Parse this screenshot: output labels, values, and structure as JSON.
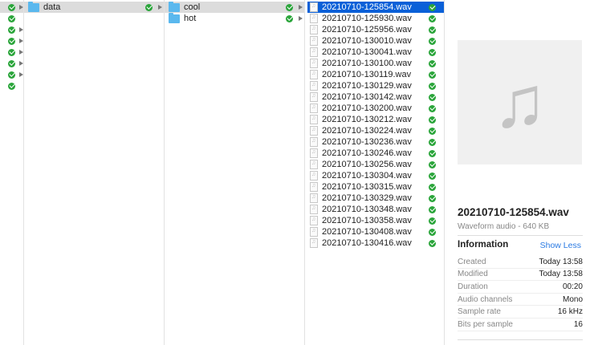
{
  "column0": {
    "rows": [
      {
        "arrow": true
      },
      {
        "arrow": false
      },
      {
        "arrow": true
      },
      {
        "arrow": true
      },
      {
        "arrow": true
      },
      {
        "arrow": true
      },
      {
        "arrow": true
      },
      {
        "arrow": false
      }
    ]
  },
  "column1": {
    "items": [
      {
        "name": "data"
      }
    ]
  },
  "column2": {
    "items": [
      {
        "name": "cool"
      },
      {
        "name": "hot"
      }
    ]
  },
  "column3": {
    "files": [
      "20210710-125854.wav",
      "20210710-125930.wav",
      "20210710-125956.wav",
      "20210710-130010.wav",
      "20210710-130041.wav",
      "20210710-130100.wav",
      "20210710-130119.wav",
      "20210710-130129.wav",
      "20210710-130142.wav",
      "20210710-130200.wav",
      "20210710-130212.wav",
      "20210710-130224.wav",
      "20210710-130236.wav",
      "20210710-130246.wav",
      "20210710-130256.wav",
      "20210710-130304.wav",
      "20210710-130315.wav",
      "20210710-130329.wav",
      "20210710-130348.wav",
      "20210710-130358.wav",
      "20210710-130408.wav",
      "20210710-130416.wav"
    ]
  },
  "preview": {
    "title": "20210710-125854.wav",
    "subtitle": "Waveform audio - 640 KB",
    "info_heading": "Information",
    "show_less": "Show Less",
    "info": [
      {
        "k": "Created",
        "v": "Today 13:58"
      },
      {
        "k": "Modified",
        "v": "Today 13:58"
      },
      {
        "k": "Duration",
        "v": "00:20"
      },
      {
        "k": "Audio channels",
        "v": "Mono"
      },
      {
        "k": "Sample rate",
        "v": "16 kHz"
      },
      {
        "k": "Bits per sample",
        "v": "16"
      }
    ]
  },
  "colors": {
    "accent": "#0a60d8",
    "link": "#2a7ae2",
    "check": "#2aa53a"
  }
}
